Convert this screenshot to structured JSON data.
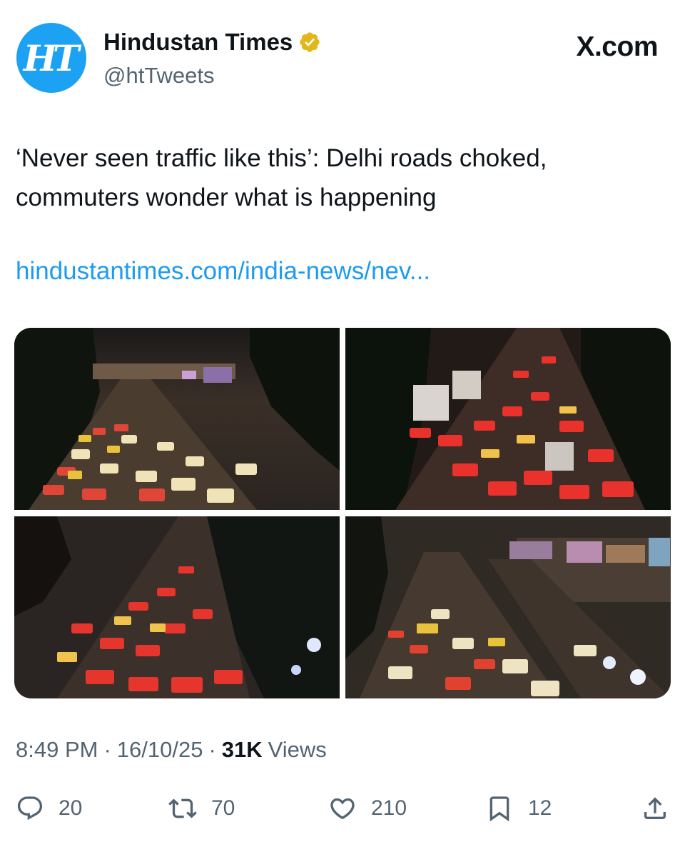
{
  "author": {
    "display_name": "Hindustan Times",
    "handle": "@htTweets",
    "avatar_logo_text": "HT",
    "verified_badge_color": "#e2b719"
  },
  "platform_label": "X.com",
  "tweet": {
    "text": "‘Never seen traffic like this’: Delhi roads choked, commuters wonder what is happening",
    "link_text": "hindustantimes.com/india-news/nev..."
  },
  "media": {
    "count": 4,
    "descriptions": [
      "night-traffic-photo-1",
      "night-traffic-photo-2",
      "night-traffic-photo-3",
      "night-traffic-photo-4"
    ]
  },
  "meta": {
    "time": "8:49 PM",
    "separator": "·",
    "date": "16/10/25",
    "views_count": "31K",
    "views_label": "Views"
  },
  "actions": {
    "replies": "20",
    "reposts": "70",
    "likes": "210",
    "bookmarks": "12"
  },
  "colors": {
    "text": "#0f1419",
    "secondary": "#536471",
    "link": "#1d9bf0",
    "avatar_bg": "#1da1f2"
  }
}
